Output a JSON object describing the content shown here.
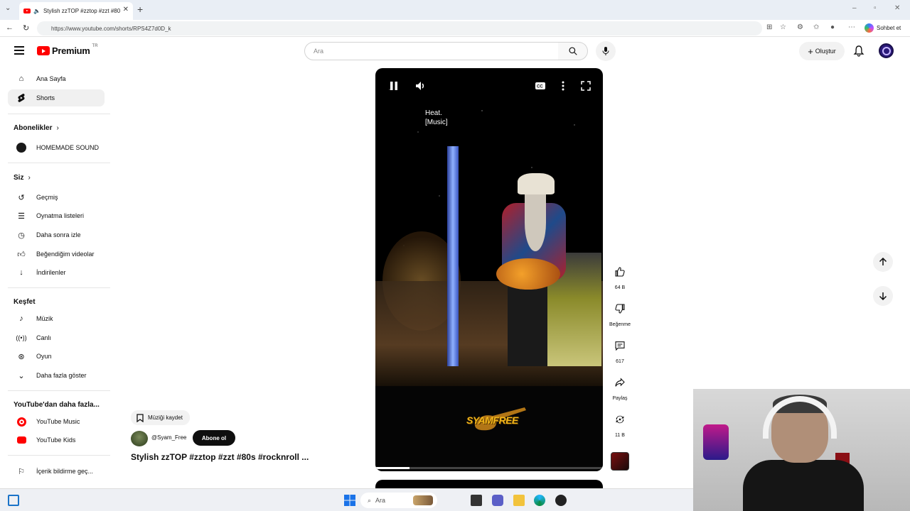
{
  "browser": {
    "tab_title": "Stylish zzTOP #zztop #zzt #80",
    "url": "https://www.youtube.com/shorts/RPS4Z7d0D_k",
    "copilot_label": "Sohbet et"
  },
  "header": {
    "logo_word": "Premium",
    "logo_region": "TR",
    "search_placeholder": "Ara",
    "create_label": "Oluştur"
  },
  "sidebar": {
    "main": [
      {
        "label": "Ana Sayfa",
        "icon": "home-icon"
      },
      {
        "label": "Shorts",
        "icon": "shorts-icon"
      }
    ],
    "subscriptions_heading": "Abonelikler",
    "subscriptions": [
      {
        "label": "HOMEMADE SOUND"
      }
    ],
    "you_heading": "Siz",
    "you": [
      {
        "label": "Geçmiş",
        "icon": "history-icon"
      },
      {
        "label": "Oynatma listeleri",
        "icon": "playlist-icon"
      },
      {
        "label": "Daha sonra izle",
        "icon": "clock-icon"
      },
      {
        "label": "Beğendiğim videolar",
        "icon": "thumbs-up-icon"
      },
      {
        "label": "İndirilenler",
        "icon": "download-icon"
      }
    ],
    "explore_heading": "Keşfet",
    "explore": [
      {
        "label": "Müzik",
        "icon": "music-icon"
      },
      {
        "label": "Canlı",
        "icon": "live-icon"
      },
      {
        "label": "Oyun",
        "icon": "gamepad-icon"
      },
      {
        "label": "Daha fazla göster",
        "icon": "chevron-down-icon"
      }
    ],
    "more_heading": "YouTube'dan daha fazla...",
    "more": [
      {
        "label": "YouTube Music",
        "icon": "youtube-music-icon"
      },
      {
        "label": "YouTube Kids",
        "icon": "youtube-kids-icon"
      }
    ],
    "report": {
      "label": "İçerik bildirme geç...",
      "icon": "flag-icon"
    }
  },
  "video": {
    "caption_line1": "Heat.",
    "caption_line2": "[Music]",
    "watermark": "SYAMFREE",
    "progress_fraction": 0.15,
    "save_music_label": "Müziği kaydet",
    "channel_handle": "@Syam_Free",
    "subscribe_label": "Abone ol",
    "title": "Stylish zzTOP #zztop #zzt #80s #rocknroll ..."
  },
  "actions": {
    "likes": "64 B",
    "dislike_label": "Beğenme",
    "comments": "617",
    "share_label": "Paylaş",
    "remix_count": "11 B"
  },
  "taskbar": {
    "search_label": "Ara"
  },
  "colors": {
    "brand_red": "#ff0000",
    "accent_dark": "#0f0f0f"
  }
}
